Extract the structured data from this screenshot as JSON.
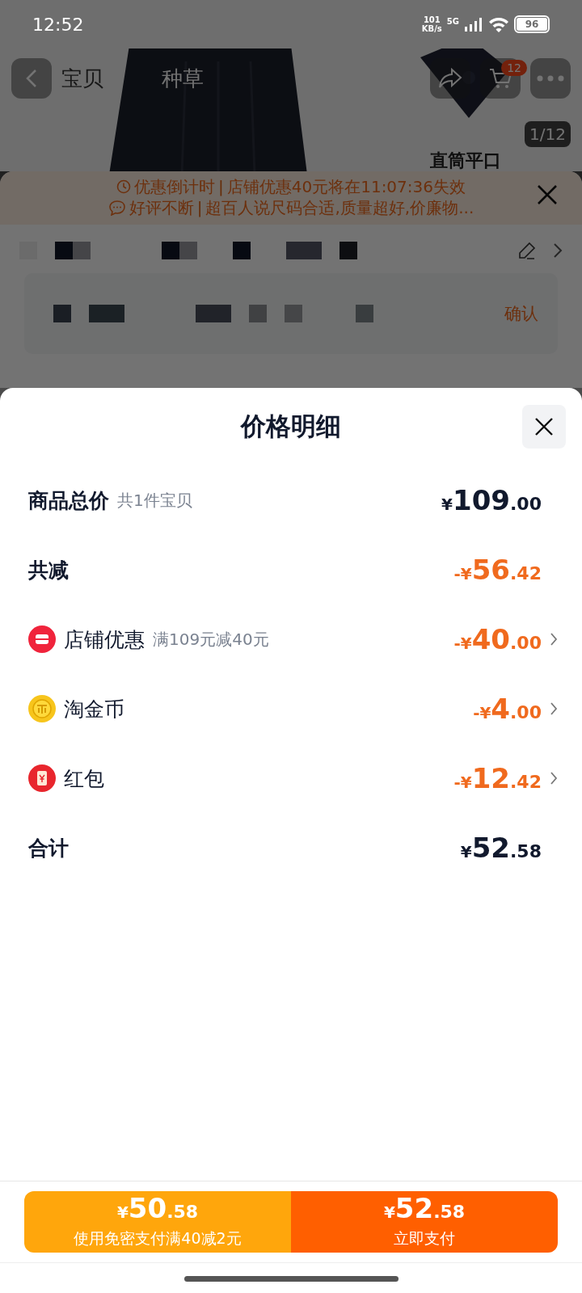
{
  "status_bar": {
    "time": "12:52",
    "speed": "101",
    "speed_unit": "KB/s",
    "network": "5G",
    "battery": "96"
  },
  "background_page": {
    "tabs": [
      "宝贝",
      "种草"
    ],
    "cart_count": "12",
    "image_counter": "1/12",
    "product_caption": "直筒平口",
    "notices": [
      {
        "kind": "clock",
        "title": "优惠倒计时",
        "separator": "|",
        "text": "店铺优惠40元将在11:07:36失效"
      },
      {
        "kind": "chat",
        "title": "好评不断",
        "separator": "|",
        "text": "超百人说尺码合适,质量超好,价廉物..."
      }
    ],
    "confirm": "确认"
  },
  "sheet": {
    "title": "价格明细",
    "rows": [
      {
        "kind": "total",
        "label": "商品总价",
        "note": "共1件宝贝",
        "price": {
          "prefix": "¥",
          "whole": "109",
          "fraction": ".00"
        },
        "discount": false,
        "chevron": false
      },
      {
        "kind": "plain",
        "label": "共减",
        "price": {
          "prefix": "-¥",
          "whole": "56",
          "fraction": ".42"
        },
        "discount": true,
        "chevron": false
      },
      {
        "kind": "store",
        "label": "店铺优惠",
        "note": "满109元减40元",
        "price": {
          "prefix": "-¥",
          "whole": "40",
          "fraction": ".00"
        },
        "discount": true,
        "chevron": true
      },
      {
        "kind": "coin",
        "label": "淘金币",
        "price": {
          "prefix": "-¥",
          "whole": "4",
          "fraction": ".00"
        },
        "discount": true,
        "chevron": true
      },
      {
        "kind": "redpacket",
        "label": "红包",
        "price": {
          "prefix": "-¥",
          "whole": "12",
          "fraction": ".42"
        },
        "discount": true,
        "chevron": true
      },
      {
        "kind": "plain",
        "label": "合计",
        "price": {
          "prefix": "¥",
          "whole": "52",
          "fraction": ".58"
        },
        "discount": false,
        "chevron": false
      }
    ]
  },
  "pay_buttons": [
    {
      "kind": "secondary",
      "price": {
        "prefix": "¥",
        "whole": "50",
        "fraction": ".58"
      },
      "label": "使用免密支付满40减2元"
    },
    {
      "kind": "primary",
      "price": {
        "prefix": "¥",
        "whole": "52",
        "fraction": ".58"
      },
      "label": "立即支付"
    }
  ]
}
